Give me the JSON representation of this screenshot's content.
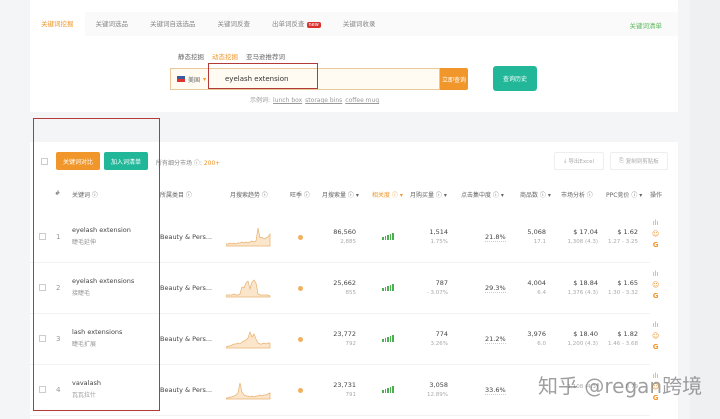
{
  "tabs": [
    {
      "label": "关键词挖掘",
      "active": true
    },
    {
      "label": "关键词选品"
    },
    {
      "label": "关键词自选选品"
    },
    {
      "label": "关键词反查"
    },
    {
      "label": "出单词反查",
      "badge": "new"
    },
    {
      "label": "关键词收录"
    }
  ],
  "keyword_list_link": "关键词清单",
  "subtabs": [
    {
      "label": "静态挖掘"
    },
    {
      "label": "动态挖掘",
      "active": true
    },
    {
      "label": "亚马逊推荐词"
    }
  ],
  "search": {
    "country": "美国",
    "value": "eyelash extension",
    "submit": "立即查询",
    "history": "查询历史"
  },
  "examples": {
    "label": "示例词:",
    "items": [
      "lunch box",
      "storage bins",
      "coffee mug"
    ]
  },
  "toolbar": {
    "compare": "关键词对比",
    "add_list": "加入词清单",
    "market_label": "所有细分市场 ⓘ:",
    "market_count": "200+",
    "export": "导出Excel",
    "copy": "复制到剪贴板"
  },
  "columns": [
    "#",
    "关键词 ⓘ",
    "所属类目 ⓘ",
    "月搜索趋势 ⓘ",
    "旺季 ⓘ",
    "月搜索量 ⓘ ▾",
    "相关度 ⓘ ▾",
    "月购买量 ⓘ ▾",
    "点击集中度 ⓘ ▾",
    "商品数 ⓘ ▾",
    "市场分析 ⓘ",
    "PPC竞价 ⓘ ▾",
    "操作"
  ],
  "rows": [
    {
      "n": "1",
      "kw": "eyelash extension",
      "zh": "睫毛延伸",
      "cat": "Beauty & Pers...",
      "search": "86,560",
      "search_sub": "2,885",
      "buy": "1,514",
      "buy_sub": "1.75%",
      "click": "21.8%",
      "products": "5,068",
      "products_sub": "17.1",
      "market": "$ 17.04",
      "market_sub": "1,308 (4.3)",
      "ppc": "$ 1.62",
      "ppc_sub": "1.27 - 3.25",
      "trend": [
        2,
        2,
        3,
        2,
        3,
        2,
        3,
        3,
        4,
        3,
        4,
        3,
        4,
        5,
        4,
        5,
        18,
        8,
        9,
        7,
        8,
        9,
        12
      ]
    },
    {
      "n": "2",
      "kw": "eyelash extensions",
      "zh": "接睫毛",
      "cat": "Beauty & Pers...",
      "search": "25,662",
      "search_sub": "855",
      "buy": "787",
      "buy_sub": "- 3.07%",
      "click": "29.3%",
      "products": "4,004",
      "products_sub": "6.4",
      "market": "$ 18.84",
      "market_sub": "1,376 (4.3)",
      "ppc": "$ 1.65",
      "ppc_sub": "1.30 - 3.32",
      "trend": [
        2,
        2,
        2,
        2,
        3,
        2,
        2,
        3,
        10,
        9,
        14,
        16,
        8,
        15,
        17,
        14,
        3,
        2,
        2,
        2,
        2,
        2,
        1
      ]
    },
    {
      "n": "3",
      "kw": "lash extensions",
      "zh": "睫毛扩展",
      "cat": "Beauty & Pers...",
      "search": "23,772",
      "search_sub": "792",
      "buy": "774",
      "buy_sub": "3.26%",
      "click": "21.2%",
      "products": "3,976",
      "products_sub": "6.0",
      "market": "$ 18.40",
      "market_sub": "1,200 (4.3)",
      "ppc": "$ 1.82",
      "ppc_sub": "1.46 - 3.68",
      "trend": [
        1,
        2,
        2,
        3,
        4,
        4,
        5,
        4,
        6,
        7,
        8,
        10,
        16,
        11,
        14,
        9,
        5,
        4,
        4,
        5,
        4,
        5,
        5
      ]
    },
    {
      "n": "4",
      "kw": "vavalash",
      "zh": "瓦瓦拉什",
      "cat": "Beauty & Pers...",
      "search": "23,731",
      "search_sub": "791",
      "buy": "3,058",
      "buy_sub": "12.89%",
      "click": "33.6%",
      "products": "",
      "products_sub": "",
      "market": "",
      "market_sub": "1,108 (4.3)",
      "ppc": "",
      "ppc_sub": "0.79",
      "trend": [
        1,
        1,
        2,
        2,
        3,
        4,
        6,
        16,
        7,
        4,
        3,
        3,
        2,
        3,
        2,
        3,
        3,
        4,
        3,
        4,
        4,
        5,
        6
      ]
    }
  ],
  "watermark": "知乎 @regan跨境"
}
